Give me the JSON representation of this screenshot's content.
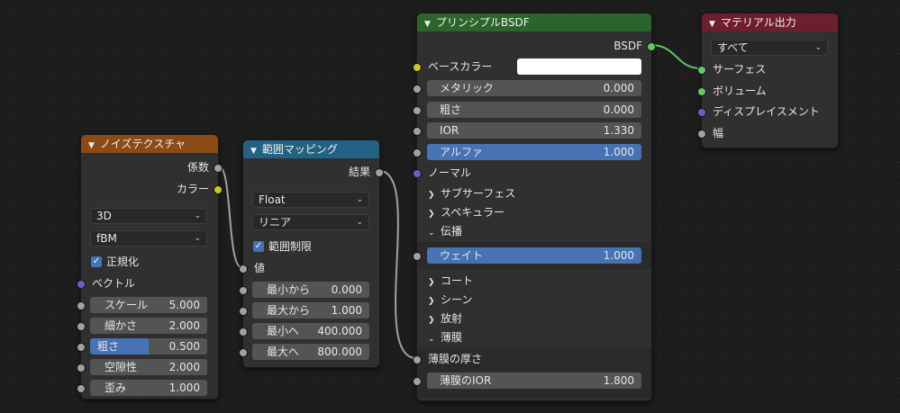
{
  "colors": {
    "noise_header": "#8a4b17",
    "map_header": "#246283",
    "bsdf_header": "#2b652b",
    "output_header": "#6e1f2e",
    "socket_gray": "#a1a1a1",
    "socket_yellow": "#c7c729",
    "socket_purple": "#6363c7",
    "socket_green": "#63c763",
    "field_blue": "#4772b3"
  },
  "noise": {
    "title": "ノイズテクスチャ",
    "out_fac": "係数",
    "out_color": "カラー",
    "dim": "3D",
    "type": "fBM",
    "normalize_label": "正規化",
    "vector": "ベクトル",
    "fields": [
      {
        "label": "スケール",
        "value": "5.000"
      },
      {
        "label": "細かさ",
        "value": "2.000"
      },
      {
        "label": "粗さ",
        "value": "0.500",
        "fill": 0.5
      },
      {
        "label": "空隙性",
        "value": "2.000"
      },
      {
        "label": "歪み",
        "value": "1.000"
      }
    ]
  },
  "map": {
    "title": "範囲マッピング",
    "out_result": "結果",
    "data_type": "Float",
    "interp": "リニア",
    "clamp_label": "範囲制限",
    "value_label": "値",
    "fields": [
      {
        "label": "最小から",
        "value": "0.000"
      },
      {
        "label": "最大から",
        "value": "1.000"
      },
      {
        "label": "最小へ",
        "value": "400.000"
      },
      {
        "label": "最大へ",
        "value": "800.000"
      }
    ]
  },
  "bsdf": {
    "title": "プリンシプルBSDF",
    "out_bsdf": "BSDF",
    "base_color": "ベースカラー",
    "metallic": {
      "label": "メタリック",
      "value": "0.000"
    },
    "roughness": {
      "label": "粗さ",
      "value": "0.000"
    },
    "ior": {
      "label": "IOR",
      "value": "1.330"
    },
    "alpha": {
      "label": "アルファ",
      "value": "1.000"
    },
    "normal": "ノーマル",
    "subsurface": "サブサーフェス",
    "specular": "スペキュラー",
    "transmission": "伝播",
    "weight": {
      "label": "ウェイト",
      "value": "1.000"
    },
    "coat": "コート",
    "sheen": "シーン",
    "emission": "放射",
    "thin_film": "薄膜",
    "thin_film_thickness": "薄膜の厚さ",
    "thin_film_ior": {
      "label": "薄膜のIOR",
      "value": "1.800"
    }
  },
  "output": {
    "title": "マテリアル出力",
    "target": "すべて",
    "surface": "サーフェス",
    "volume": "ボリューム",
    "displacement": "ディスプレイスメント",
    "thickness": "幅"
  }
}
